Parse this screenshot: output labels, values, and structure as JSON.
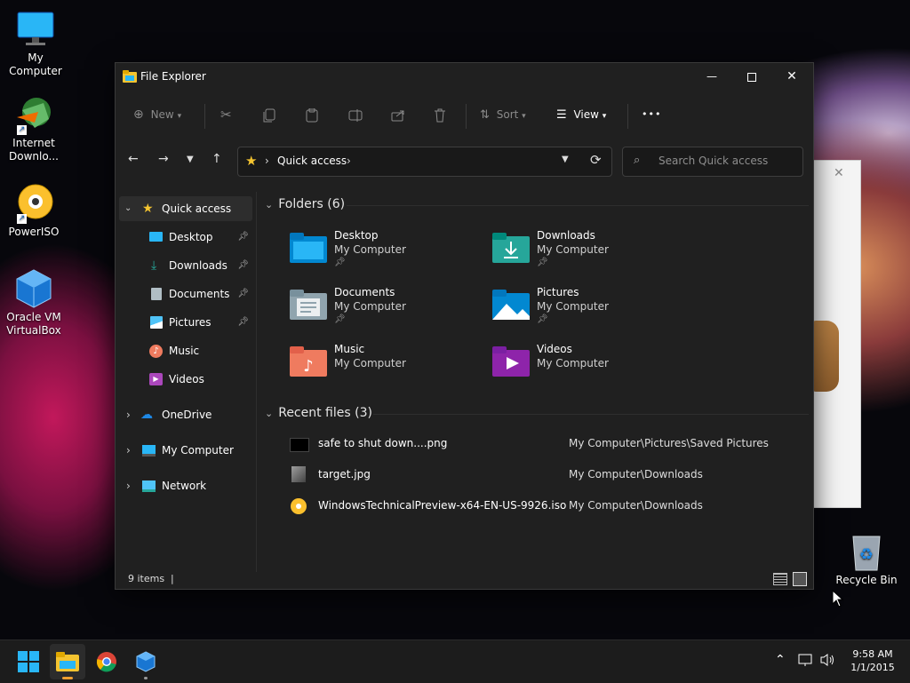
{
  "desktop": {
    "icons": [
      {
        "label": "My Computer"
      },
      {
        "label": "Internet Downlo..."
      },
      {
        "label": "PowerISO"
      },
      {
        "label": "Oracle VM VirtualBox"
      },
      {
        "label": "Recycle Bin"
      }
    ]
  },
  "window": {
    "title": "File Explorer",
    "toolbar": {
      "new": "New",
      "sort": "Sort",
      "view": "View",
      "more": "•••"
    },
    "address": {
      "location": "Quick access",
      "search_placeholder": "Search Quick access"
    },
    "sidebar": {
      "quick_access": "Quick access",
      "pinned": [
        "Desktop",
        "Downloads",
        "Documents",
        "Pictures"
      ],
      "others": [
        "Music",
        "Videos"
      ],
      "onedrive": "OneDrive",
      "my_computer": "My Computer",
      "network": "Network"
    },
    "folders_header": "Folders (6)",
    "folders": [
      {
        "name": "Desktop",
        "location": "My Computer",
        "pinned": true
      },
      {
        "name": "Downloads",
        "location": "My Computer",
        "pinned": true
      },
      {
        "name": "Documents",
        "location": "My Computer",
        "pinned": true
      },
      {
        "name": "Pictures",
        "location": "My Computer",
        "pinned": true
      },
      {
        "name": "Music",
        "location": "My Computer",
        "pinned": false
      },
      {
        "name": "Videos",
        "location": "My Computer",
        "pinned": false
      }
    ],
    "recent_header": "Recent files (3)",
    "recent_files": [
      {
        "name": "safe to shut down....png",
        "path": "My Computer\\Pictures\\Saved Pictures"
      },
      {
        "name": "target.jpg",
        "path": "My Computer\\Downloads"
      },
      {
        "name": "WindowsTechnicalPreview-x64-EN-US-9926.iso",
        "path": "My Computer\\Downloads"
      }
    ],
    "status": "9 items"
  },
  "taskbar": {
    "time": "9:58 AM",
    "date": "1/1/2015"
  },
  "colors": {
    "accent": "#0078d4",
    "window_bg": "#202020",
    "folder_yellow": "#f4c430"
  }
}
